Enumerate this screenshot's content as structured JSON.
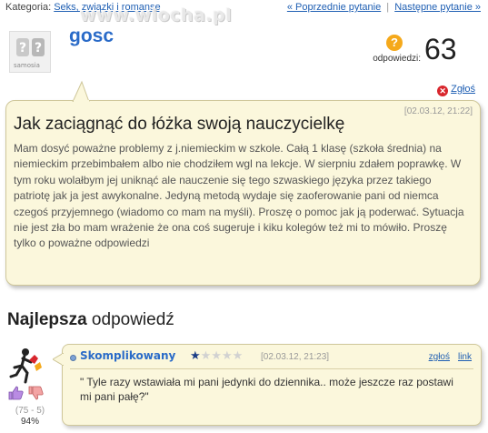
{
  "header": {
    "category_label": "Kategoria:",
    "category": "Seks, związki i romanse",
    "prev_label": "« Poprzednie pytanie",
    "separator": "|",
    "next_label": "Następne pytanie »"
  },
  "watermark": "www.wiocha.pl",
  "question": {
    "avatar_brand": "samosia",
    "username": "gosc",
    "answers_label": "odpowiedzi:",
    "answers_count": "63",
    "report_label": "Zgłoś",
    "date": "[02.03.12, 21:22]",
    "title": "Jak zaciągnąć do łóżka swoją nauczycielkę",
    "body": "Mam dosyć poważne problemy z j.niemieckim w szkole. Całą 1 klasę (szkoła średnia) na niemieckim przebimbałem albo nie chodziłem wgl na lekcje. W sierpniu zdałem poprawkę. W tym roku wolałbym jej uniknąć ale nauczenie się tego szwaskiego języka przez takiego patriotę jak ja jest awykonalne. Jedyną metodą wydaje się zaoferowanie pani od niemca czegoś przyjemnego (wiadomo co mam na myśli). Proszę o pomoc jak ją poderwać. Sytuacja nie jest zła bo mam wrażenie że ona coś sugeruje i kiku kolegów też mi to mówiło. Proszę tylko o poważne odpowiedzi"
  },
  "best_answer": {
    "heading_bold": "Najlepsza",
    "heading_rest": " odpowiedź",
    "username": "Skomplikowany",
    "stars": "★☆☆☆☆",
    "rating": 1,
    "rating_max": 5,
    "date": "[02.03.12, 21:23]",
    "report_label": "zgłoś",
    "link_label": "link",
    "text": "\" Tyle razy wstawiała mi pani jedynki do dziennika.. może jeszcze raz postawi mi pani pałę?\"",
    "votes_ratio": "(75 - 5)",
    "votes_percent": "94%"
  },
  "colors": {
    "link": "#1f5fb3",
    "username": "#2a6bc8",
    "box_bg": "#fbf7dc",
    "box_border": "#cfc79a"
  }
}
